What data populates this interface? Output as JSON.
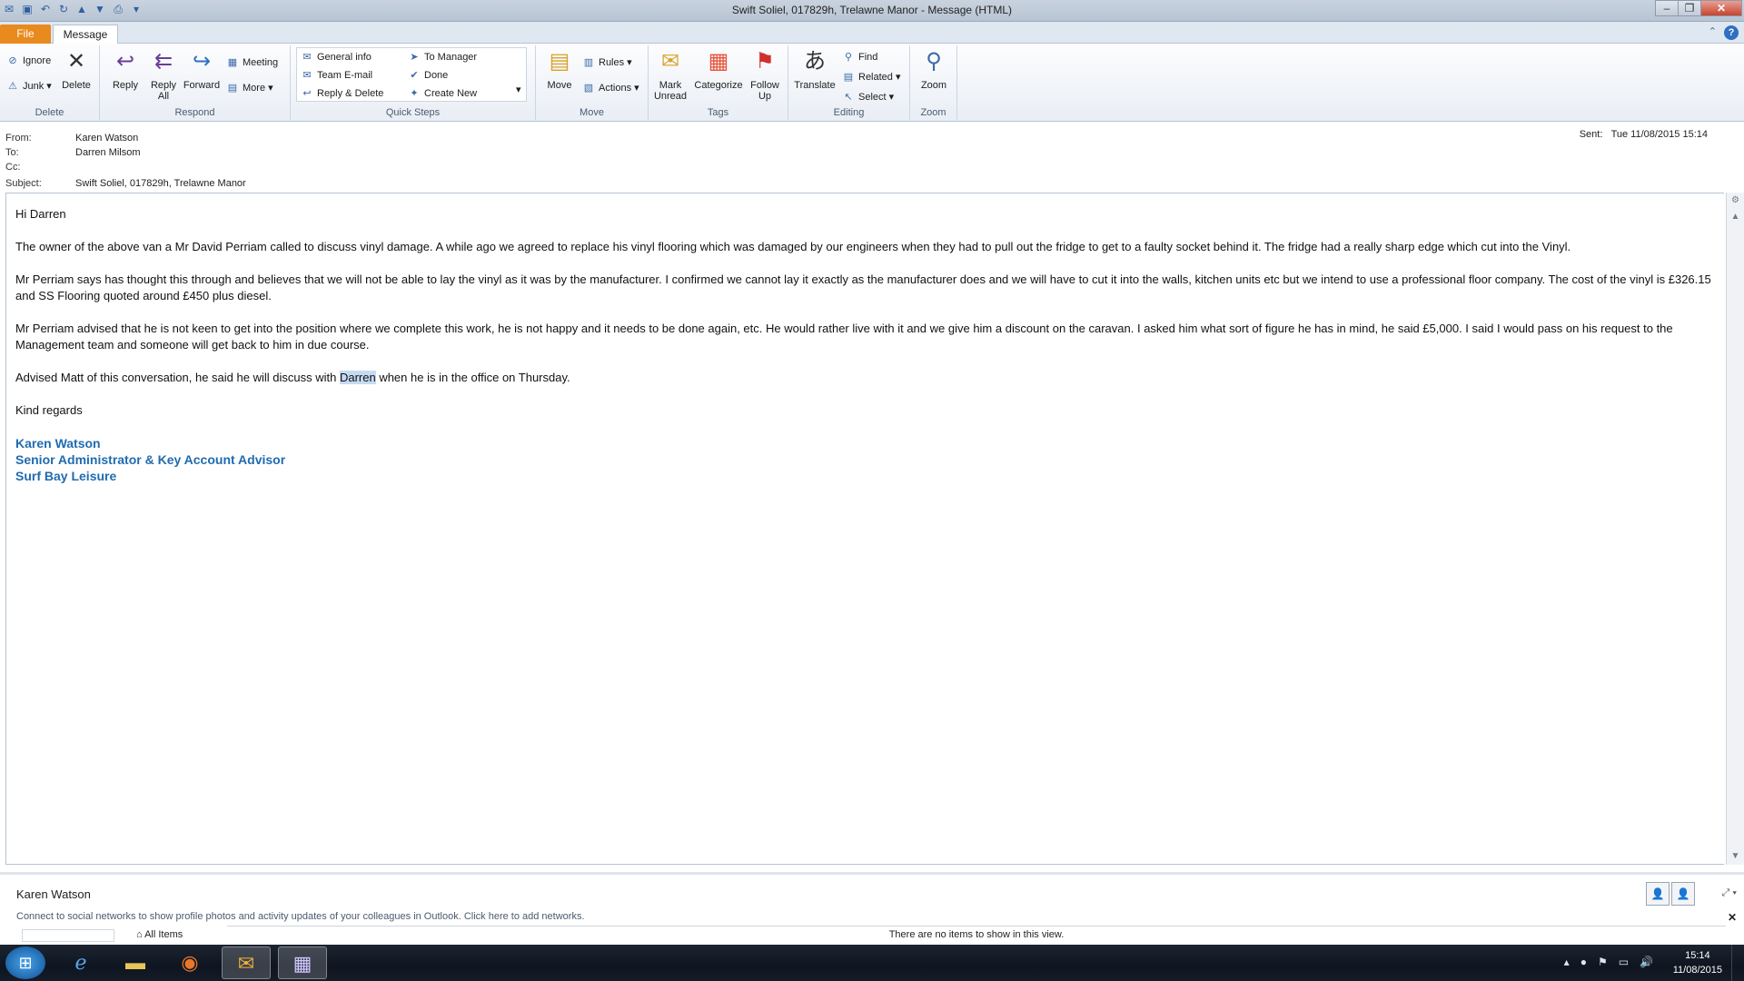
{
  "window": {
    "title": "Swift Soliel,  017829h, Trelawne Manor  -  Message (HTML)"
  },
  "tabs": {
    "file": "File",
    "message": "Message"
  },
  "ribbon": {
    "delete_group": {
      "ignore": "Ignore",
      "junk": "Junk",
      "delete": "Delete",
      "label": "Delete"
    },
    "respond_group": {
      "reply": "Reply",
      "reply_all_1": "Reply",
      "reply_all_2": "All",
      "forward": "Forward",
      "meeting": "Meeting",
      "more": "More",
      "label": "Respond"
    },
    "quicksteps_group": {
      "general_info": "General info",
      "team_email": "Team E-mail",
      "reply_delete": "Reply & Delete",
      "to_manager": "To Manager",
      "done": "Done",
      "create_new": "Create New",
      "label": "Quick Steps"
    },
    "move_group": {
      "move": "Move",
      "rules": "Rules",
      "actions": "Actions",
      "label": "Move"
    },
    "tags_group": {
      "mark_unread_1": "Mark",
      "mark_unread_2": "Unread",
      "categorize": "Categorize",
      "follow_up_1": "Follow",
      "follow_up_2": "Up",
      "label": "Tags"
    },
    "editing_group": {
      "translate": "Translate",
      "find": "Find",
      "related": "Related",
      "select": "Select",
      "label": "Editing"
    },
    "zoom_group": {
      "zoom": "Zoom",
      "label": "Zoom"
    }
  },
  "header": {
    "from_label": "From:",
    "from": "Karen Watson",
    "to_label": "To:",
    "to": "Darren Milsom",
    "cc_label": "Cc:",
    "cc": "",
    "subject_label": "Subject:",
    "subject": "Swift Soliel,  017829h, Trelawne Manor",
    "sent_label": "Sent:",
    "sent": "Tue 11/08/2015 15:14"
  },
  "body": {
    "greeting": "Hi Darren",
    "p1": "The owner of the above van a Mr David Perriam called to discuss vinyl damage. A while ago we agreed to replace his vinyl flooring which was damaged by our engineers when they had to pull out the fridge to get to a faulty socket behind it. The fridge had a really sharp edge which cut into the Vinyl.",
    "p2": "Mr Perriam says has thought this through and believes that we will not be able to lay the vinyl as it was by the manufacturer. I confirmed we cannot lay it exactly as the manufacturer does and we will have to cut it into the walls, kitchen units etc but we intend to use a professional floor company.  The cost of the vinyl is £326.15 and SS Flooring quoted around £450 plus diesel.",
    "p3": "Mr Perriam advised that he is not keen to get into the position where we complete this work, he is not happy and it needs to be done again, etc. He would rather live with it and we give him a discount on the caravan. I asked him what sort of figure he has in mind, he said £5,000. I said I would pass on his request to the Management team and someone will get back to him in due course.",
    "p4_pre": "Advised Matt of this conversation, he said he will discuss with ",
    "p4_highlight": "Darren",
    "p4_post": " when he is in the office on Thursday.",
    "closing": "Kind regards",
    "sig_name": "Karen Watson",
    "sig_title": "Senior Administrator & Key Account Advisor",
    "sig_company": "Surf Bay Leisure"
  },
  "people_pane": {
    "name": "Karen Watson",
    "note": "Connect to social networks to show profile photos and activity updates of your colleagues in Outlook. Click here to add networks.",
    "filter": "All Items",
    "empty": "There are no items to show in this view."
  },
  "taskbar": {
    "time": "15:14",
    "date": "11/08/2015"
  },
  "colors": {
    "signature": "#1f6bb0",
    "file_tab": "#e88a1d",
    "highlight": "#c6dbf3"
  }
}
